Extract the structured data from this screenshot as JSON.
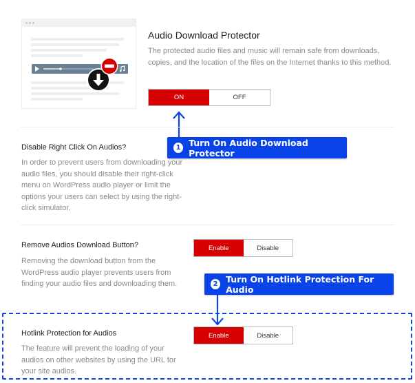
{
  "main": {
    "title": "Audio Download Protector",
    "description": "The protected audio files and music will remain safe from downloads, copies, and the location of the files on the Internet thanks to this method.",
    "toggle": {
      "on_label": "ON",
      "off_label": "OFF",
      "selected": "ON"
    }
  },
  "settings": [
    {
      "label": "Disable Right Click On Audios?",
      "description": "In order to prevent users from downloading your audio files, you should disable their right-click menu on WordPress audio player or limit the options your users can select by using the right-click simulator."
    },
    {
      "label": "Remove Audios Download Button?",
      "description": "Removing the download button from the WordPress audio player prevents users from finding your audio files and downloading them.",
      "toggle": {
        "enable_label": "Enable",
        "disable_label": "Disable",
        "selected": "Enable"
      }
    },
    {
      "label": "Hotlink Protection for Audios",
      "description": "The feature will prevent the loading of your audios on other websites by using the URL for your site audios.",
      "toggle": {
        "enable_label": "Enable",
        "disable_label": "Disable",
        "selected": "Enable"
      }
    }
  ],
  "callouts": [
    {
      "number": "1",
      "text": "Turn On Audio Download Protector"
    },
    {
      "number": "2",
      "text": "Turn On Hotlink Protection For Audio"
    }
  ],
  "illustration": {
    "icons": [
      "play-icon",
      "music-note-icon",
      "download-icon",
      "no-entry-icon"
    ]
  },
  "colors": {
    "accent_red": "#d60000",
    "callout_blue": "#0a44e8",
    "description_gray": "#8a8a8a"
  }
}
